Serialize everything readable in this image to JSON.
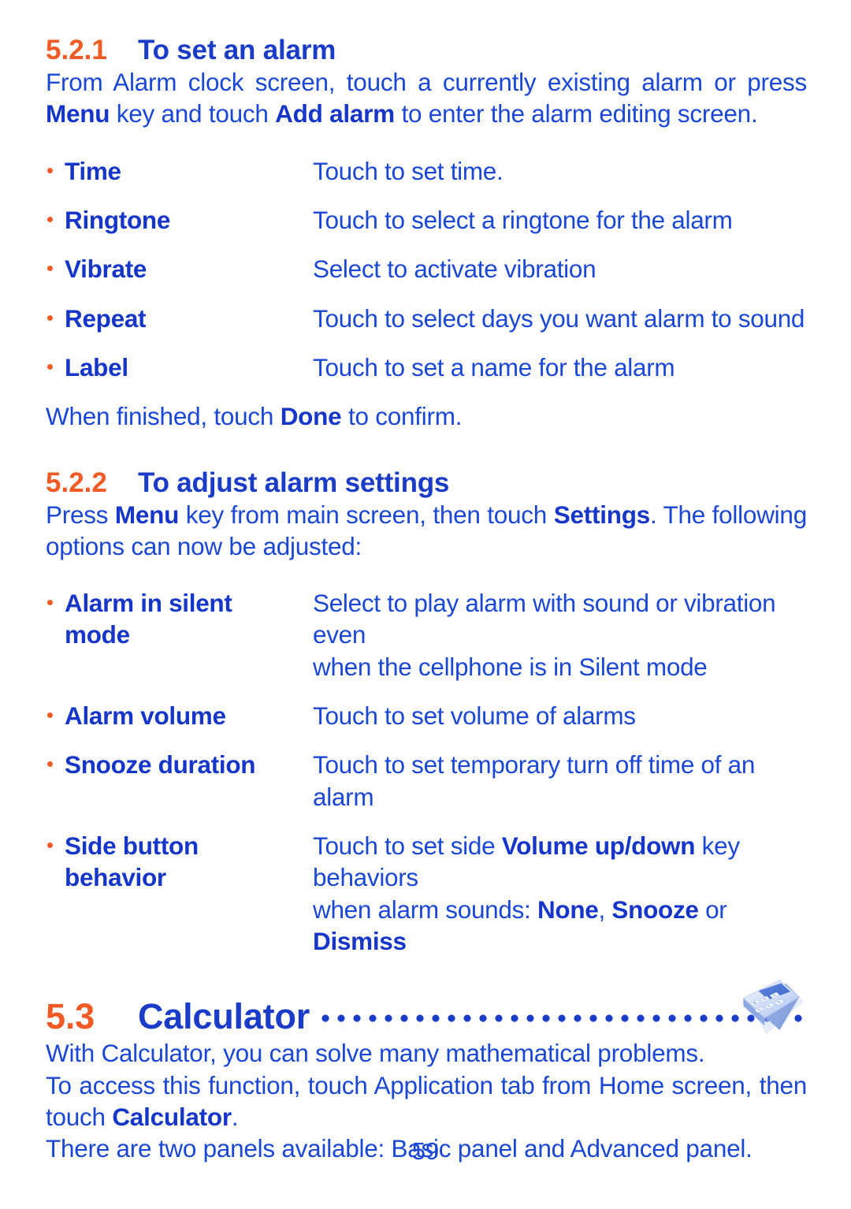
{
  "page": {
    "number": "59",
    "colors": {
      "accent_orange": "#F15A24",
      "heading_blue": "#1A3CC8",
      "body_blue": "#1A47D6"
    }
  },
  "sections": [
    {
      "number": "5.2.1",
      "title": "To set an alarm",
      "intro": {
        "part1": "From Alarm clock screen, touch a currently existing alarm or press ",
        "bold1": "Menu",
        "part2": " key and touch ",
        "bold2": "Add alarm",
        "part3": " to enter the alarm editing screen."
      },
      "items": [
        {
          "term": "Time",
          "term_line2": "",
          "desc": "Touch to set time.",
          "desc_line2": ""
        },
        {
          "term": "Ringtone",
          "term_line2": "",
          "desc": "Touch to select a ringtone for the alarm",
          "desc_line2": ""
        },
        {
          "term": "Vibrate",
          "term_line2": "",
          "desc": "Select to activate vibration",
          "desc_line2": ""
        },
        {
          "term": "Repeat",
          "term_line2": "",
          "desc": "Touch to select days you want alarm to sound",
          "desc_line2": ""
        },
        {
          "term": "Label",
          "term_line2": "",
          "desc": "Touch to set a name for the alarm",
          "desc_line2": ""
        }
      ],
      "outro": {
        "part1": "When finished, touch ",
        "bold1": "Done",
        "part2": " to confirm."
      }
    },
    {
      "number": "5.2.2",
      "title": "To adjust alarm settings",
      "intro": {
        "part1": "Press ",
        "bold1": "Menu",
        "part2": " key from main screen, then touch ",
        "bold2": "Settings",
        "part3": ". The following options can now be adjusted:"
      },
      "items": [
        {
          "term": "Alarm in silent",
          "term_line2": "mode",
          "desc": "Select to play alarm with sound or vibration even",
          "desc_line2": "when the cellphone is in Silent mode"
        },
        {
          "term": "Alarm volume",
          "term_line2": "",
          "desc": "Touch to set volume of alarms",
          "desc_line2": ""
        },
        {
          "term": "Snooze duration",
          "term_line2": "",
          "desc": "Touch to set temporary turn off time of an alarm",
          "desc_line2": ""
        },
        {
          "term": "Side button",
          "term_line2": "behavior",
          "desc_rich_line1": {
            "part1": "Touch to set side ",
            "bold1": "Volume up/down",
            "part2": " key behaviors"
          },
          "desc_rich_line2": {
            "part1": "when alarm sounds: ",
            "bold1": "None",
            "part2": ", ",
            "bold2": "Snooze",
            "part3": " or ",
            "bold3": "Dismiss"
          }
        }
      ]
    }
  ],
  "calculator_section": {
    "number": "5.3",
    "title": "Calculator",
    "icon": "calculator-icon",
    "paragraph1": "With Calculator, you can solve many mathematical problems.",
    "paragraph2": {
      "part1": "To access this function, touch Application tab from Home screen, then touch ",
      "bold1": "Calculator",
      "part2": "."
    },
    "paragraph3": "There are two panels available: Basic panel and Advanced panel."
  }
}
